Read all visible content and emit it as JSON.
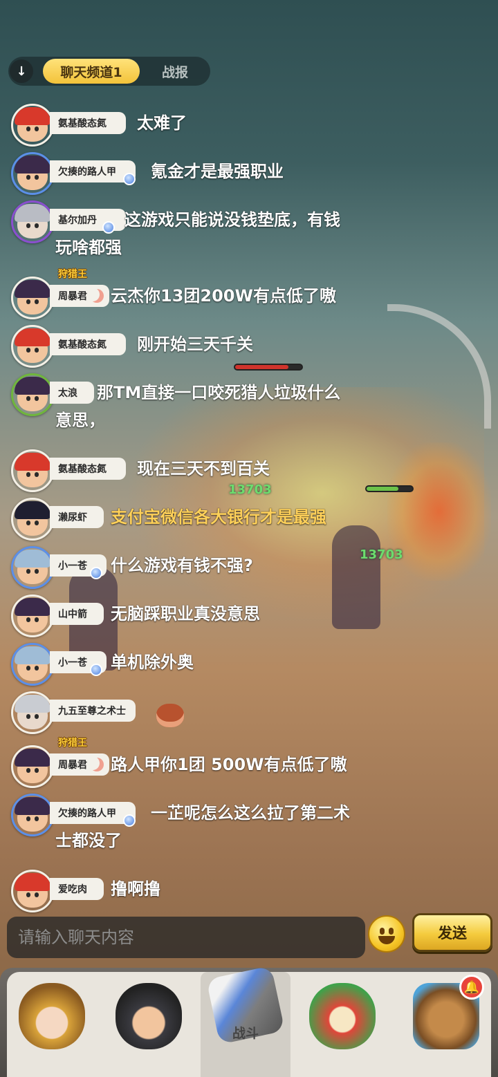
{
  "chat": {
    "tabs": [
      {
        "label": "聊天频道1"
      },
      {
        "label": "战报"
      }
    ],
    "messages": [
      {
        "name": "氨基酸态氮",
        "text": "太难了"
      },
      {
        "name": "欠揍的路人甲",
        "text": "氪金才是最强职业"
      },
      {
        "name": "基尔加丹",
        "text": "这游戏只能说没钱垫底，有钱",
        "text2": "玩啥都强"
      },
      {
        "name": "周暴君",
        "title": "狩猎王",
        "text": "云杰你13团200W有点低了嗷"
      },
      {
        "name": "氨基酸态氮",
        "text": "刚开始三天千关"
      },
      {
        "name": "太浪",
        "text": "那TM直接一口咬死猎人垃圾什么",
        "text2": "意思，"
      },
      {
        "name": "氨基酸态氮",
        "text": "现在三天不到百关"
      },
      {
        "name": "濑尿虾",
        "text": "支付宝微信各大银行才是最强",
        "highlight": true
      },
      {
        "name": "小一苍",
        "text": "什么游戏有钱不强?"
      },
      {
        "name": "山中箭",
        "text": "无脑踩职业真没意思"
      },
      {
        "name": "小一苍",
        "text": "单机除外奥"
      },
      {
        "name": "九五至尊之术士",
        "text": ""
      },
      {
        "name": "周暴君",
        "title": "狩猎王",
        "text": "路人甲你1团 500W有点低了嗷"
      },
      {
        "name": "欠揍的路人甲",
        "text": "一芷呢怎么这么拉了第二术",
        "text2": "士都没了"
      },
      {
        "name": "爱吃肉",
        "text": "撸啊撸"
      }
    ],
    "input_placeholder": "请输入聊天内容",
    "send_label": "发送"
  },
  "scene": {
    "floating_numbers": [
      "13703",
      "13703"
    ]
  },
  "nav": {
    "items": [
      {
        "label": ""
      },
      {
        "label": ""
      },
      {
        "label": "战斗"
      },
      {
        "label": ""
      },
      {
        "label": ""
      }
    ],
    "notification_icon": "bell-icon"
  },
  "colors": {
    "tab_active": "#f3c33a",
    "send_button": "#f4cb3d",
    "highlight_text": "#ffd15a"
  }
}
